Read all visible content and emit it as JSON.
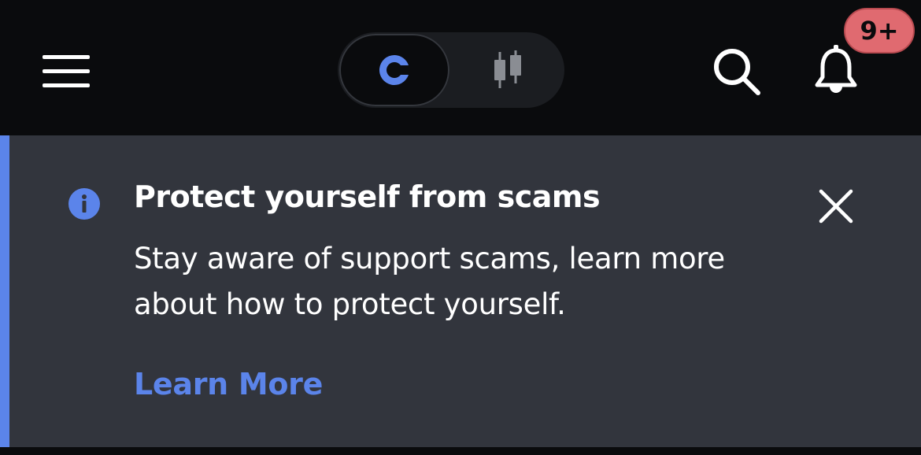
{
  "header": {
    "menu_icon": "hamburger-menu-icon",
    "toggle": {
      "options": [
        {
          "icon": "coinbase-logo-icon",
          "selected": true
        },
        {
          "icon": "candlestick-chart-icon",
          "selected": false
        }
      ]
    },
    "search_icon": "search-icon",
    "bell_icon": "bell-icon",
    "notification_badge": "9+"
  },
  "banner": {
    "icon": "info-icon",
    "title": "Protect yourself from scams",
    "body": "Stay aware of support scams, learn more about how to protect yourself.",
    "link_label": "Learn More",
    "close_icon": "close-icon"
  },
  "colors": {
    "background": "#0a0b0d",
    "banner_background": "#32353d",
    "accent_blue": "#5b84ea",
    "badge_red": "#e06a70",
    "text_white": "#ffffff"
  }
}
